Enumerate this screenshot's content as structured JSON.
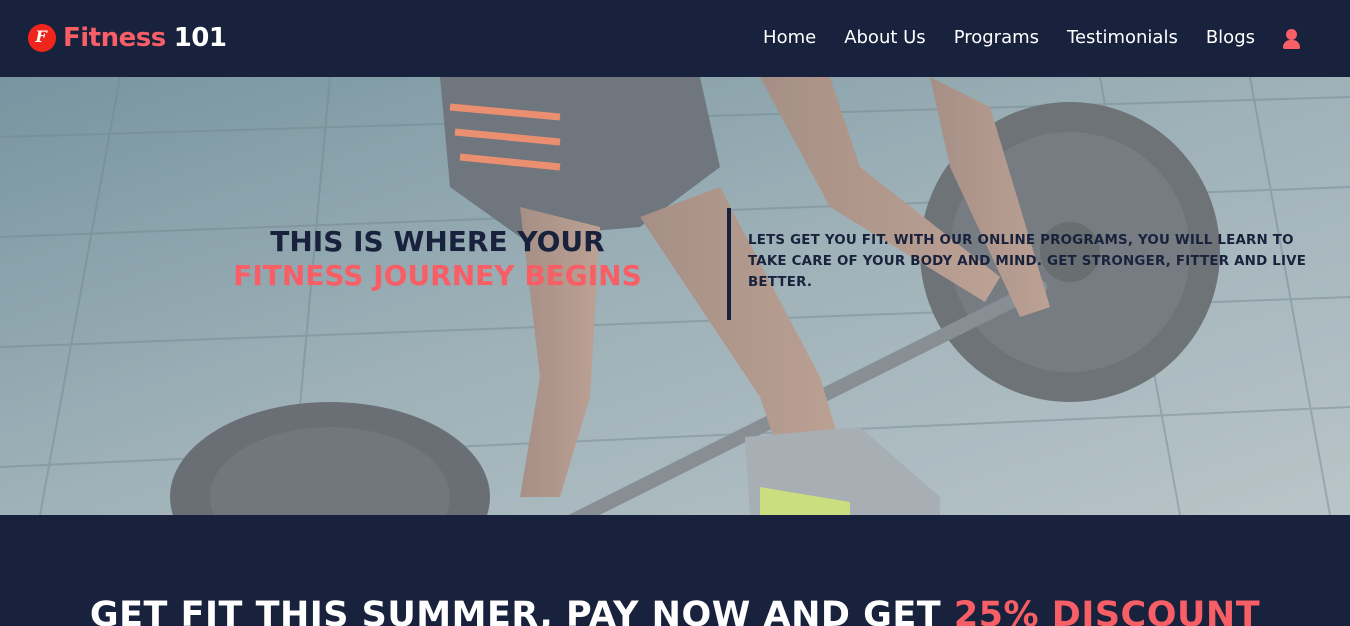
{
  "brand": {
    "logo_letter": "F",
    "name": "Fitness",
    "number": "101"
  },
  "nav": {
    "links": [
      "Home",
      "About Us",
      "Programs",
      "Testimonials",
      "Blogs"
    ],
    "profile_icon": "user-icon"
  },
  "hero": {
    "title_line1": "THIS IS WHERE YOUR",
    "title_line2": "FITNESS JOURNEY BEGINS",
    "description": "LETS GET YOU FIT. WITH OUR ONLINE PROGRAMS, YOU WILL LEARN TO TAKE CARE OF YOUR BODY AND MIND. GET STRONGER, FITTER AND LIVE BETTER."
  },
  "promo": {
    "text": "GET FIT THIS SUMMER, PAY NOW AND GET",
    "highlight": "25% DISCOUNT"
  },
  "colors": {
    "navy": "#19223d",
    "accent": "#f85e65",
    "logo_red": "#f0261c"
  }
}
